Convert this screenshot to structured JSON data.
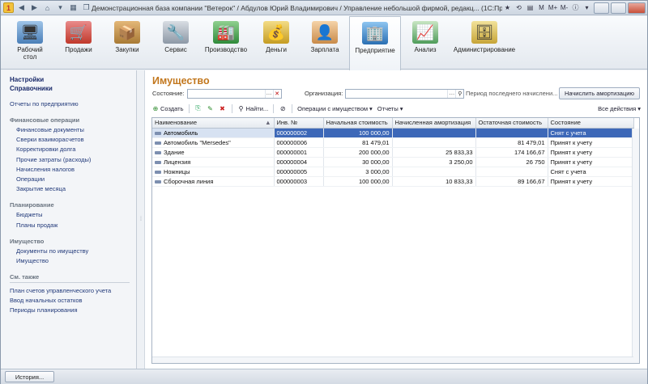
{
  "titlebar": {
    "title": "Демонстрационная база компании \"Ветерок\" / Абдулов Юрий Владимирович / Управление небольшой фирмой, редакц... (1С:Предприятие)",
    "m_buttons": [
      "M",
      "M+",
      "M-"
    ]
  },
  "sections": [
    {
      "label": "Рабочий стол",
      "icon": "desktop-icon"
    },
    {
      "label": "Продажи",
      "icon": "cart-icon"
    },
    {
      "label": "Закупки",
      "icon": "boxes-icon"
    },
    {
      "label": "Сервис",
      "icon": "tools-icon"
    },
    {
      "label": "Производство",
      "icon": "factory-icon"
    },
    {
      "label": "Деньги",
      "icon": "coins-icon"
    },
    {
      "label": "Зарплата",
      "icon": "person-icon"
    },
    {
      "label": "Предприятие",
      "icon": "building-icon"
    },
    {
      "label": "Анализ",
      "icon": "chart-icon"
    },
    {
      "label": "Администрирование",
      "icon": "database-icon"
    }
  ],
  "left_panel": {
    "settings": "Настройки",
    "directories": "Справочники",
    "reports": "Отчеты по предприятию",
    "group_finance": "Финансовые операции",
    "finance_items": [
      "Финансовые документы",
      "Сверки взаиморасчетов",
      "Корректировки долга",
      "Прочие затраты (расходы)",
      "Начисления налогов",
      "Операции",
      "Закрытие месяца"
    ],
    "group_planning": "Планирование",
    "planning_items": [
      "Бюджеты",
      "Планы продаж"
    ],
    "group_property": "Имущество",
    "property_items": [
      "Документы по имуществу",
      "Имущество"
    ],
    "see_also": "См. также",
    "see_also_items": [
      "План счетов управленческого учета",
      "Ввод начальных остатков",
      "Периоды планирования"
    ]
  },
  "form": {
    "title": "Имущество",
    "state_label": "Состояние:",
    "org_label": "Организация:",
    "period_label": "Период последнего начислени...",
    "amort_button": "Начислить амортизацию",
    "create": "Создать",
    "find": "Найти...",
    "ops": "Операции с имуществом",
    "reports": "Отчеты",
    "all_actions": "Все действия"
  },
  "table": {
    "columns": [
      "Наименование",
      "Инв. №",
      "Начальная стоимость",
      "Начисленная амортизация",
      "Остаточная стоимость",
      "Состояние"
    ],
    "rows": [
      {
        "name": "Автомобиль",
        "inv": "000000002",
        "start": "100 000,00",
        "amort": "",
        "rest": "",
        "state": "Снят с учета"
      },
      {
        "name": "Автомобиль \"Mersedes\"",
        "inv": "000000006",
        "start": "81 479,01",
        "amort": "",
        "rest": "81 479,01",
        "state": "Принят к учету"
      },
      {
        "name": "Здание",
        "inv": "000000001",
        "start": "200 000,00",
        "amort": "25 833,33",
        "rest": "174 166,67",
        "state": "Принят к учету"
      },
      {
        "name": "Лицензия",
        "inv": "000000004",
        "start": "30 000,00",
        "amort": "3 250,00",
        "rest": "26 750",
        "state": "Принят к учету"
      },
      {
        "name": "Ножницы",
        "inv": "000000005",
        "start": "3 000,00",
        "amort": "",
        "rest": "",
        "state": "Снят с учета"
      },
      {
        "name": "Сборочная линия",
        "inv": "000000003",
        "start": "100 000,00",
        "amort": "10 833,33",
        "rest": "89 166,67",
        "state": "Принят к учету"
      }
    ]
  },
  "status": {
    "history": "История..."
  }
}
